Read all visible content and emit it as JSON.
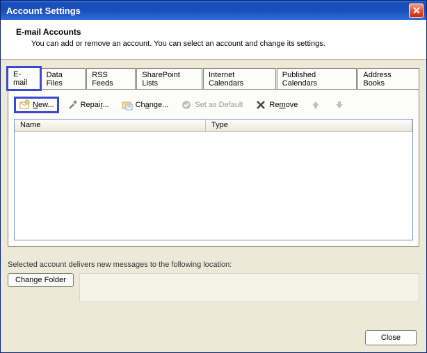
{
  "window": {
    "title": "Account Settings"
  },
  "header": {
    "title": "E-mail Accounts",
    "subtitle": "You can add or remove an account. You can select an account and change its settings."
  },
  "tabs": [
    {
      "label": "E-mail",
      "active": true,
      "highlighted": true
    },
    {
      "label": "Data Files"
    },
    {
      "label": "RSS Feeds"
    },
    {
      "label": "SharePoint Lists"
    },
    {
      "label": "Internet Calendars"
    },
    {
      "label": "Published Calendars"
    },
    {
      "label": "Address Books"
    }
  ],
  "toolbar": {
    "new_label": "New...",
    "repair_label": "Repair...",
    "change_label": "Change...",
    "setdefault_label": "Set as Default",
    "remove_label": "Remove"
  },
  "listview": {
    "columns": {
      "name": "Name",
      "type": "Type"
    },
    "rows": []
  },
  "delivery": {
    "text": "Selected account delivers new messages to the following location:",
    "change_folder_label": "Change Folder"
  },
  "buttons": {
    "close_label": "Close"
  }
}
